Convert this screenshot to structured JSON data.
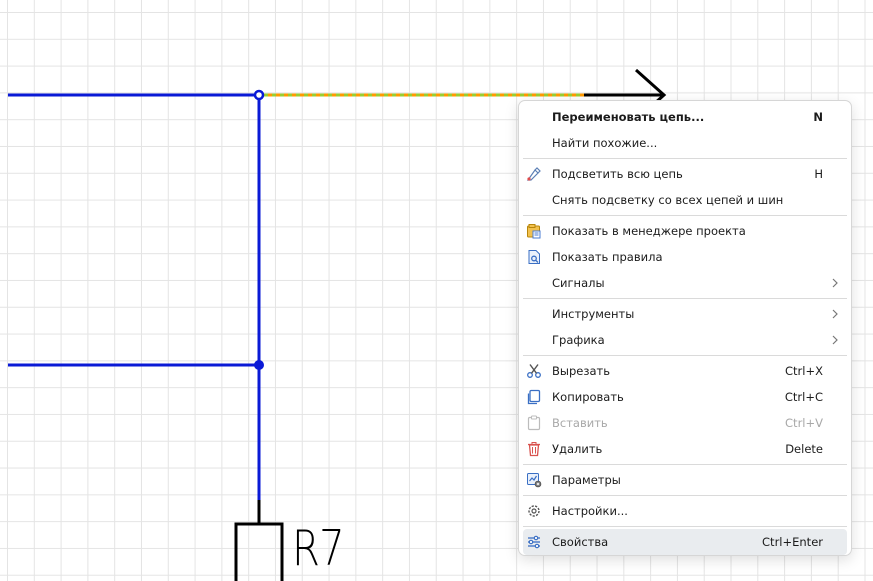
{
  "schematic": {
    "component_ref": "R7"
  },
  "context_menu": {
    "groups": [
      [
        {
          "label": "Переименовать цепь...",
          "shortcut": "N",
          "bold": true,
          "icon": null
        },
        {
          "label": "Найти похожие...",
          "shortcut": "",
          "icon": null
        }
      ],
      [
        {
          "label": "Подсветить всю цепь",
          "shortcut": "H",
          "icon": "highlight-pen-icon"
        },
        {
          "label": "Снять подсветку со всех цепей и шин",
          "shortcut": "",
          "icon": null
        }
      ],
      [
        {
          "label": "Показать в менеджере проекта",
          "shortcut": "",
          "icon": "project-manager-icon"
        },
        {
          "label": "Показать правила",
          "shortcut": "",
          "icon": "rules-icon"
        },
        {
          "label": "Сигналы",
          "shortcut": "",
          "icon": null,
          "submenu": true
        }
      ],
      [
        {
          "label": "Инструменты",
          "shortcut": "",
          "icon": null,
          "submenu": true
        },
        {
          "label": "Графика",
          "shortcut": "",
          "icon": null,
          "submenu": true
        }
      ],
      [
        {
          "label": "Вырезать",
          "shortcut": "Ctrl+X",
          "icon": "scissors-icon"
        },
        {
          "label": "Копировать",
          "shortcut": "Ctrl+C",
          "icon": "copy-icon"
        },
        {
          "label": "Вставить",
          "shortcut": "Ctrl+V",
          "icon": "paste-icon",
          "disabled": true
        },
        {
          "label": "Удалить",
          "shortcut": "Delete",
          "icon": "trash-icon"
        }
      ],
      [
        {
          "label": "Параметры",
          "shortcut": "",
          "icon": "parameters-icon"
        }
      ],
      [
        {
          "label": "Настройки...",
          "shortcut": "",
          "icon": "gear-icon"
        }
      ],
      [
        {
          "label": "Свойства",
          "shortcut": "Ctrl+Enter",
          "icon": "properties-icon",
          "hover": true
        }
      ]
    ]
  },
  "colors": {
    "wire": "#0a1ad6",
    "highlight_dash_a": "#9acd32",
    "highlight_dash_b": "#ff9a00",
    "hover_bg": "#e9ecef"
  }
}
